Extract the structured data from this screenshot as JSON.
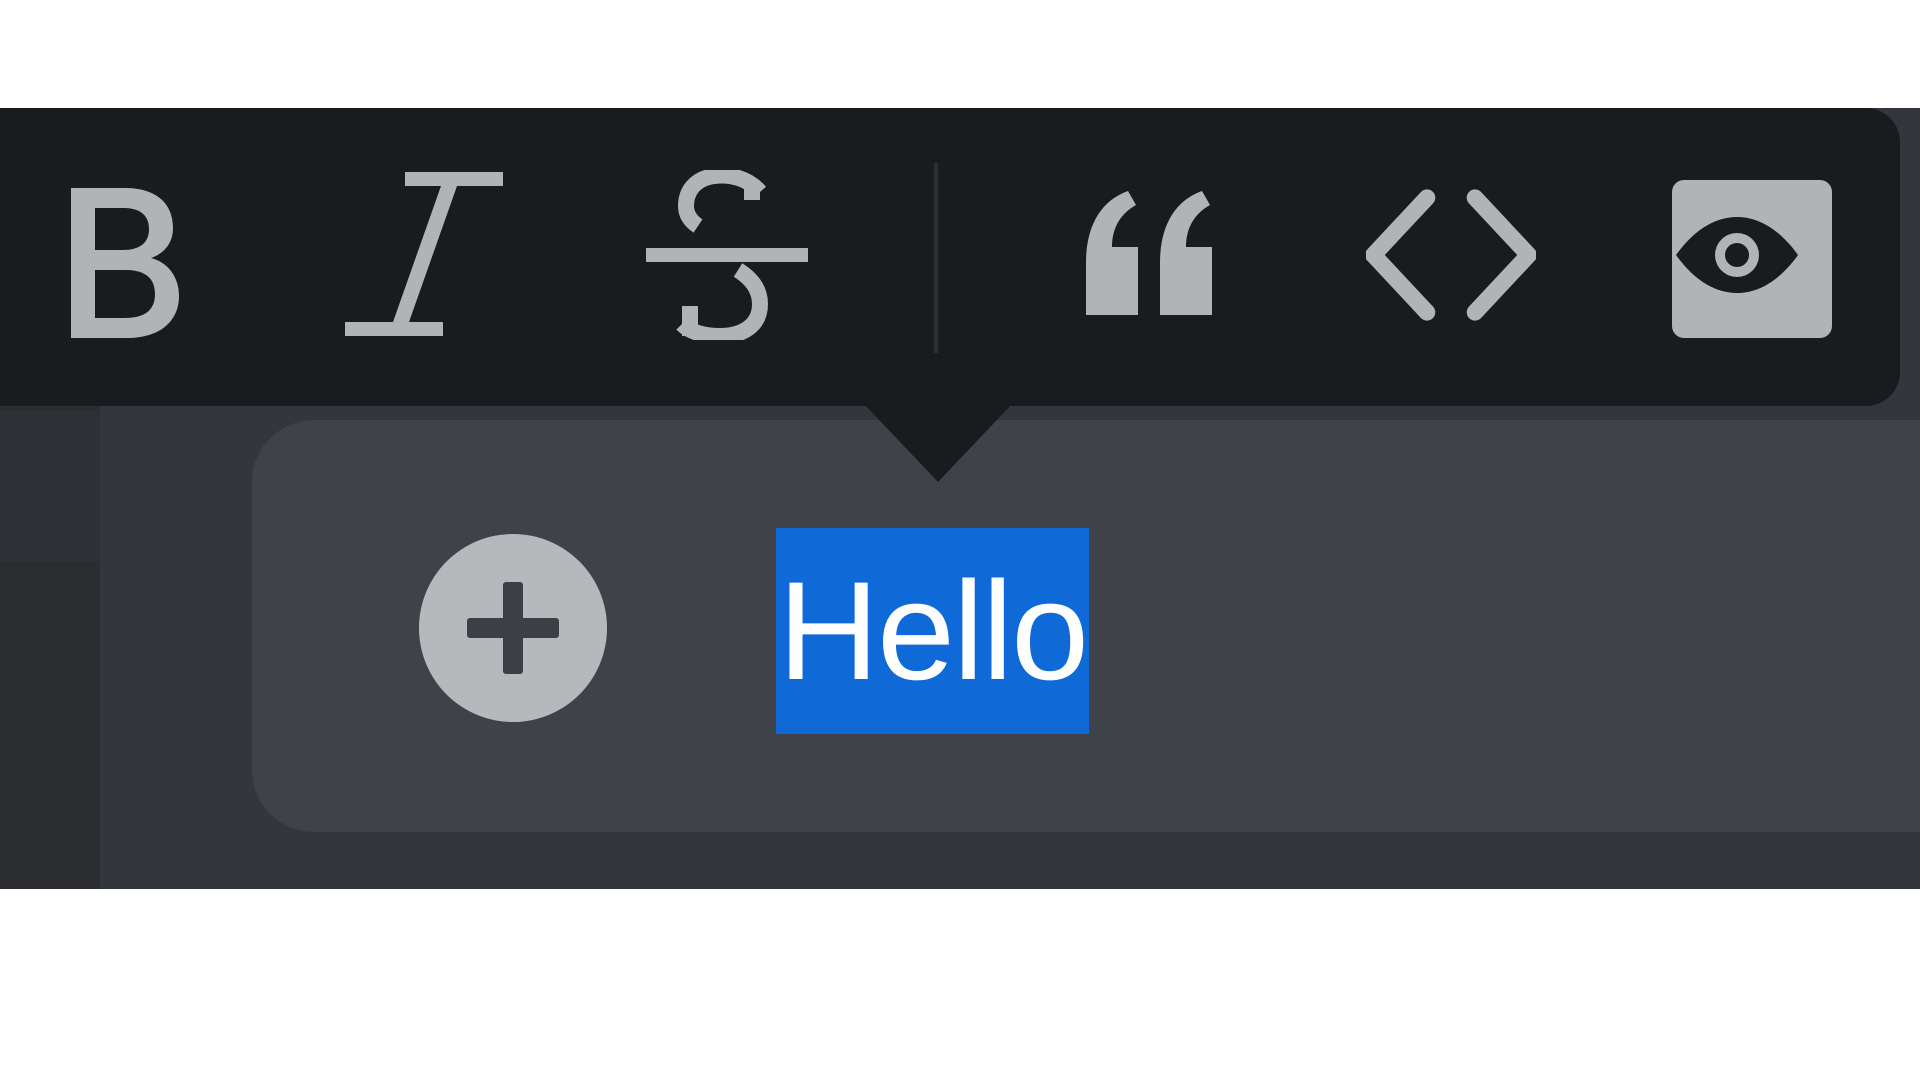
{
  "toolbar": {
    "buttons": [
      {
        "name": "bold",
        "icon": "bold-icon"
      },
      {
        "name": "italic",
        "icon": "italic-icon"
      },
      {
        "name": "strikethrough",
        "icon": "strikethrough-icon"
      },
      {
        "name": "quote",
        "icon": "quote-icon"
      },
      {
        "name": "code",
        "icon": "code-icon"
      },
      {
        "name": "spoiler",
        "icon": "eye-icon",
        "active": true
      }
    ],
    "background_color": "#1a1b1e",
    "icon_color": "#b1b3b7"
  },
  "editor": {
    "selected_text": "Hello",
    "selection_color": "#0f6ad8",
    "add_icon": "plus-icon"
  }
}
